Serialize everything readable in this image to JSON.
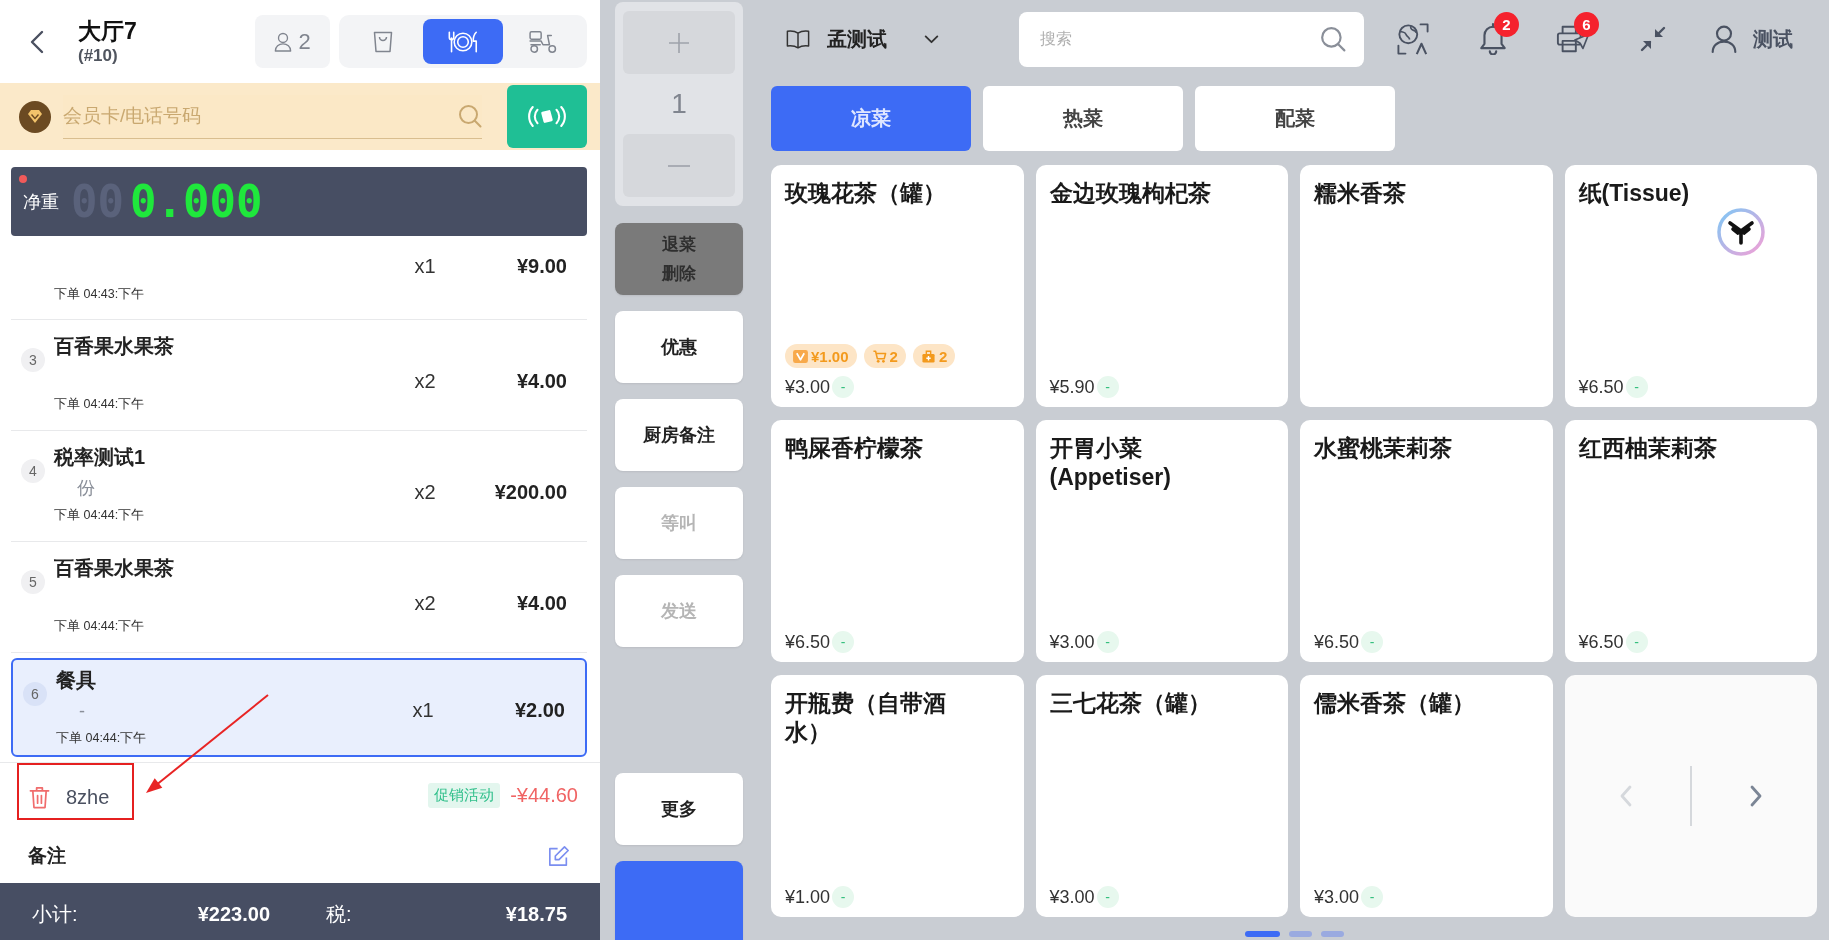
{
  "order": {
    "title": "大厅7",
    "number": "(#10)",
    "guests": "2",
    "types": [
      {
        "kind": "takeaway",
        "selected": false
      },
      {
        "kind": "dine_in",
        "selected": true
      },
      {
        "kind": "delivery",
        "selected": false
      }
    ]
  },
  "member_search": {
    "placeholder": "会员卡/电话号码"
  },
  "scale": {
    "label": "净重",
    "unlit": "00",
    "reading": "0.000"
  },
  "items": [
    {
      "kind": "clipped",
      "quantity": "x1",
      "price": "¥9.00",
      "time": "下单 04:43:下午",
      "selected": false
    },
    {
      "kind": "item",
      "index": "3",
      "name": "百香果水果茶",
      "quantity": "x2",
      "price": "¥4.00",
      "time": "下单 04:44:下午",
      "selected": false
    },
    {
      "kind": "item",
      "index": "4",
      "name": "税率测试1",
      "note": "份",
      "quantity": "x2",
      "price": "¥200.00",
      "time": "下单 04:44:下午",
      "selected": false
    },
    {
      "kind": "item",
      "index": "5",
      "name": "百香果水果茶",
      "quantity": "x2",
      "price": "¥4.00",
      "time": "下单 04:44:下午",
      "selected": false
    },
    {
      "kind": "item",
      "index": "6",
      "name": "餐具",
      "note": "-",
      "quantity": "x1",
      "price": "¥2.00",
      "time": "下单 04:44:下午",
      "selected": true
    }
  ],
  "discount": {
    "name": "8zhe",
    "tag": "促销活动",
    "amount": "-¥44.60",
    "highlighted": true
  },
  "remark": {
    "label": "备注"
  },
  "totals": [
    {
      "label": "小计:",
      "value": "¥223.00"
    },
    {
      "label": "税:",
      "value": "¥18.75"
    }
  ],
  "stepper": {
    "value": "1"
  },
  "actions": [
    {
      "kind": "dark",
      "lines": [
        "退菜",
        "删除"
      ],
      "disabled": false
    },
    {
      "kind": "light",
      "lines": [
        "优惠"
      ],
      "disabled": false
    },
    {
      "kind": "light",
      "lines": [
        "厨房备注"
      ],
      "disabled": false
    },
    {
      "kind": "light",
      "lines": [
        "等叫"
      ],
      "disabled": true
    },
    {
      "kind": "light",
      "lines": [
        "发送"
      ],
      "disabled": true
    }
  ],
  "bottom_actions": [
    {
      "kind": "light",
      "lines": [
        "更多"
      ],
      "disabled": false
    },
    {
      "kind": "primary",
      "disabled": false
    }
  ],
  "menu": {
    "name": "孟测试"
  },
  "search": {
    "placeholder": "搜索"
  },
  "toolbar": [
    {
      "kind": "globe"
    },
    {
      "kind": "bell",
      "badge": "2"
    },
    {
      "kind": "printer",
      "badge": "6"
    },
    {
      "kind": "collapse"
    }
  ],
  "user": {
    "name": "测试"
  },
  "categories": [
    {
      "label": "凉菜",
      "selected": true
    },
    {
      "label": "热菜",
      "selected": false
    },
    {
      "label": "配菜",
      "selected": false
    }
  ],
  "products": [
    {
      "kind": "product",
      "name": "玫瑰花茶（罐）",
      "tags": [
        {
          "kind": "member",
          "text": "¥1.00"
        },
        {
          "kind": "cart",
          "text": "2"
        },
        {
          "kind": "stock",
          "text": "2"
        }
      ],
      "price": "¥3.00",
      "mark": "-"
    },
    {
      "kind": "product",
      "name": "金边玫瑰枸杞茶",
      "price": "¥5.90",
      "mark": "-"
    },
    {
      "kind": "product",
      "name": "糯米香茶"
    },
    {
      "kind": "product",
      "name": "纸(Tissue)",
      "logo": true,
      "price": "¥6.50",
      "mark": "-"
    },
    {
      "kind": "product",
      "name": "鸭屎香柠檬茶",
      "price": "¥6.50",
      "mark": "-"
    },
    {
      "kind": "product",
      "name": "开胃小菜(Appetiser)",
      "price": "¥3.00",
      "mark": "-"
    },
    {
      "kind": "product",
      "name": "水蜜桃茉莉茶",
      "price": "¥6.50",
      "mark": "-"
    },
    {
      "kind": "product",
      "name": "红西柚茉莉茶",
      "price": "¥6.50",
      "mark": "-"
    },
    {
      "kind": "product",
      "name": "开瓶费（自带酒水）",
      "price": "¥1.00",
      "mark": "-"
    },
    {
      "kind": "product",
      "name": "三七花茶（罐）",
      "price": "¥3.00",
      "mark": "-"
    },
    {
      "kind": "product",
      "name": "儒米香茶（罐）",
      "price": "¥3.00",
      "mark": "-"
    },
    {
      "kind": "pager",
      "prev_disabled": true,
      "next_disabled": false
    }
  ],
  "pages": [
    {
      "selected": true
    },
    {
      "selected": false
    },
    {
      "selected": false
    }
  ]
}
